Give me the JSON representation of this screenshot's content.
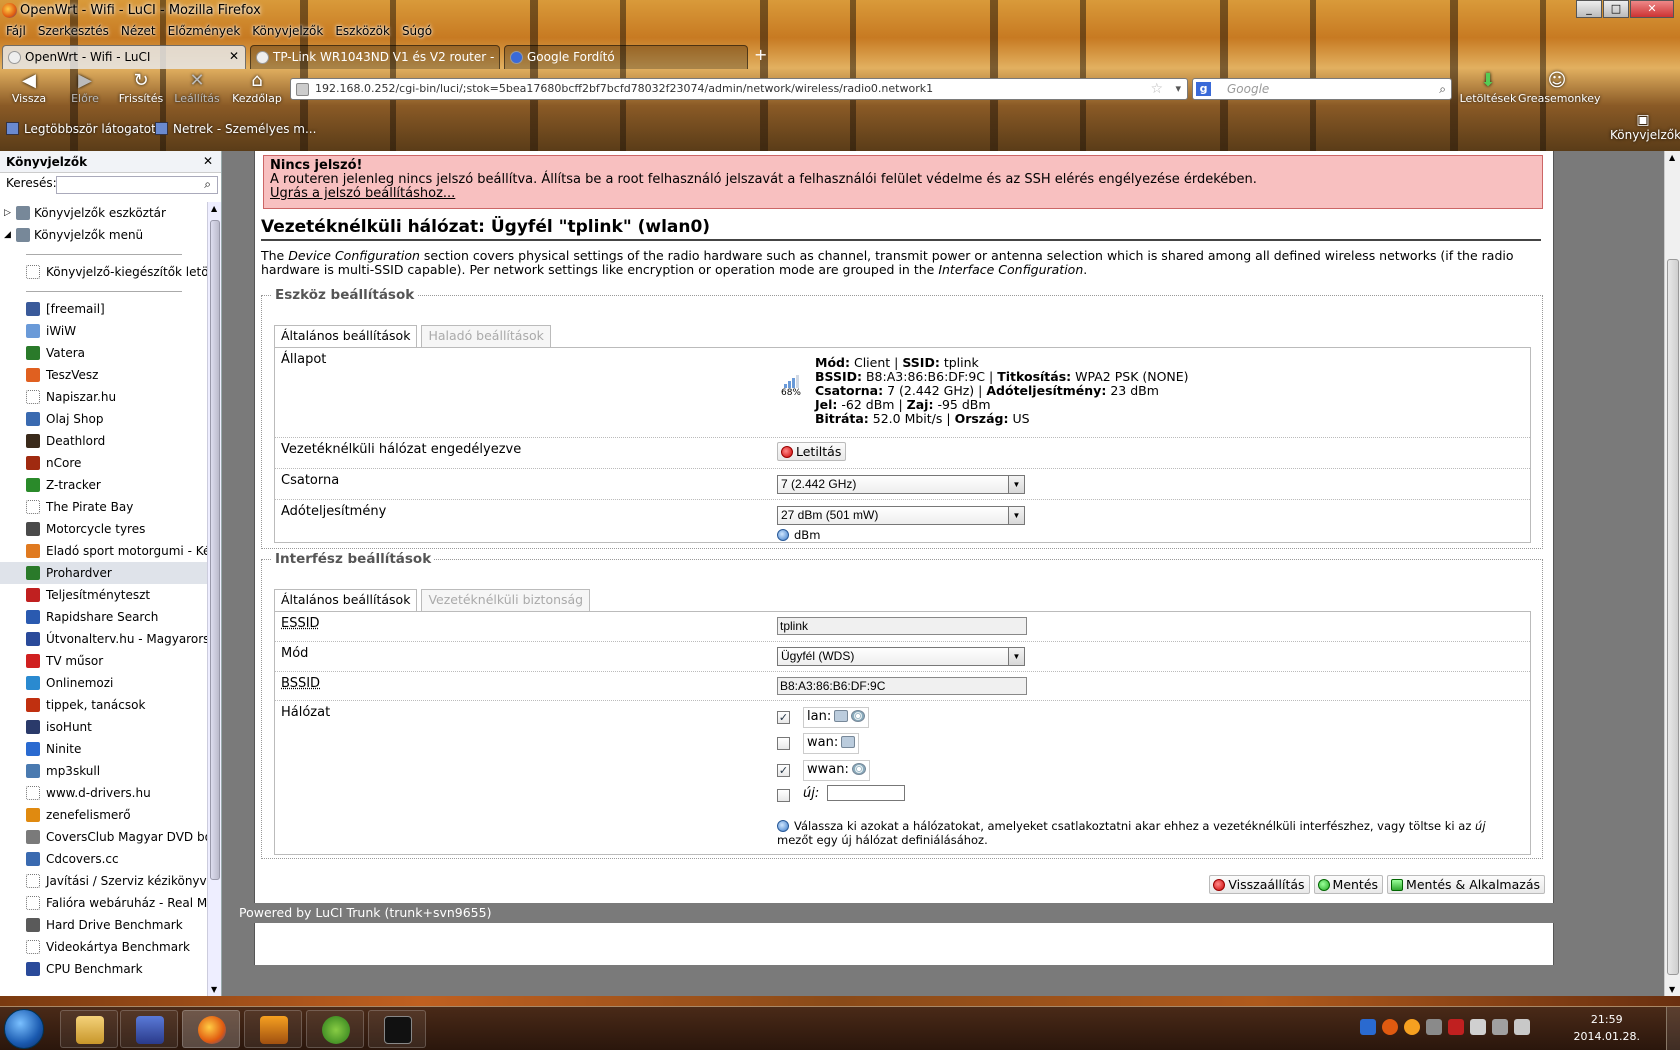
{
  "window": {
    "title": "OpenWrt - Wifi - LuCI - Mozilla Firefox",
    "min": "_",
    "max": "□",
    "close": "✕"
  },
  "menubar": [
    "Fájl",
    "Szerkesztés",
    "Nézet",
    "Előzmények",
    "Könyvjelzők",
    "Eszközök",
    "Súgó"
  ],
  "tabs": [
    {
      "label": "OpenWrt - Wifi - LuCI",
      "active": true
    },
    {
      "label": "TP-Link WR1043ND V1 és V2 router - ...",
      "active": false
    },
    {
      "label": "Google Fordító",
      "active": false
    }
  ],
  "newtab": "+",
  "nav": {
    "back": "Vissza",
    "forward": "Előre",
    "reload": "Frissítés",
    "stop": "Leállítás",
    "home": "Kezdőlap",
    "url": "192.168.0.252/cgi-bin/luci/;stok=5bea17680bcff2bf7bcfd78032f23074/admin/network/wireless/radio0.network1",
    "search_placeholder": "Google",
    "downloads": "Letöltések",
    "greasemonkey": "Greasemonkey"
  },
  "bookmarks_toolbar": {
    "most_visited": "Legtöbbször látogatott",
    "netrek": "Netrek - Személyes m...",
    "sidebar_button": "Könyvjelzők"
  },
  "sidebar": {
    "title": "Könyvjelzők",
    "close": "✕",
    "search_label": "Keresés:",
    "folders": [
      "Könyvjelzők eszköztár",
      "Könyvjelzők menü"
    ],
    "addon_item": "Könyvjelző-kiegészítők letölt...",
    "items": [
      {
        "label": "[freemail]",
        "color": "#3a5a9a"
      },
      {
        "label": "iWiW",
        "color": "#6a9ad8"
      },
      {
        "label": "Vatera",
        "color": "#2a7a2a"
      },
      {
        "label": "TeszVesz",
        "color": "#e06020"
      },
      {
        "label": "Napiszar.hu",
        "color": "#ffffff"
      },
      {
        "label": "Olaj Shop",
        "color": "#3a6ab0"
      },
      {
        "label": "Deathlord",
        "color": "#3a2a1a"
      },
      {
        "label": "nCore",
        "color": "#a02a10"
      },
      {
        "label": "Z-tracker",
        "color": "#2a8a2a"
      },
      {
        "label": "The Pirate Bay",
        "color": "#ffffff"
      },
      {
        "label": "Motorcycle tyres",
        "color": "#4a4a4a"
      },
      {
        "label": "Eladó sport motorgumi - Ké...",
        "color": "#e07a20"
      },
      {
        "label": "Prohardver",
        "color": "#2a7a2a"
      },
      {
        "label": "Teljesítményteszt",
        "color": "#c02020"
      },
      {
        "label": "Rapidshare Search",
        "color": "#2a5ab0"
      },
      {
        "label": "Útvonalterv.hu - Magyarorsz...",
        "color": "#2a4a9a"
      },
      {
        "label": "TV műsor",
        "color": "#d02020"
      },
      {
        "label": "Onlinemozi",
        "color": "#2a8ad0"
      },
      {
        "label": "tippek, tanácsok",
        "color": "#c03010"
      },
      {
        "label": "isoHunt",
        "color": "#2a3a6a"
      },
      {
        "label": "Ninite",
        "color": "#2a6ad0"
      },
      {
        "label": "mp3skull",
        "color": "#4a7ab0"
      },
      {
        "label": "www.d-drivers.hu",
        "color": "#ffffff"
      },
      {
        "label": "zenefelismerő",
        "color": "#e08a10"
      },
      {
        "label": "CoversClub Magyar DVD bo...",
        "color": "#7a7a7a"
      },
      {
        "label": "Cdcovers.cc",
        "color": "#3a6ab0"
      },
      {
        "label": "Javítási / Szerviz kézikönyvek...",
        "color": "#ffffff"
      },
      {
        "label": "Falióra webáruház - Real Ma...",
        "color": "#ffffff"
      },
      {
        "label": "Hard Drive Benchmark",
        "color": "#5a5a5a"
      },
      {
        "label": "Videokártya Benchmark",
        "color": "#ffffff"
      },
      {
        "label": "CPU Benchmark",
        "color": "#2a4a9a"
      }
    ],
    "selected_index": 12
  },
  "luci": {
    "alert": {
      "title": "Nincs jelszó!",
      "text": "A routeren jelenleg nincs jelszó beállítva. Állítsa be a root felhasználó jelszavát a felhasználói felület védelme és az SSH elérés engélyezése érdekében.",
      "link": "Ugrás a jelszó beállításhoz..."
    },
    "page_title": "Vezetéknélküli hálózat: Ügyfél \"tplink\" (wlan0)",
    "intro": {
      "p1": "The ",
      "dc": "Device Configuration",
      "p2": " section covers physical settings of the radio hardware such as channel, transmit power or antenna selection which is shared among all defined wireless networks (if the radio hardware is multi-SSID capable). Per network settings like encryption or operation mode are grouped in the ",
      "ic": "Interface Configuration",
      "p3": "."
    },
    "device": {
      "legend": "Eszköz beállítások",
      "tab_general": "Általános beállítások",
      "tab_advanced": "Haladó beállítások",
      "status_label": "Állapot",
      "signal_percent": "68%",
      "signal_level": 0.68,
      "status": {
        "mode_label": "Mód:",
        "mode": "Client",
        "ssid_label": "SSID:",
        "ssid": "tplink",
        "bssid_label": "BSSID:",
        "bssid": "B8:A3:86:B6:DF:9C",
        "enc_label": "Titkosítás:",
        "enc": "WPA2 PSK (NONE)",
        "channel_label": "Csatorna:",
        "channel": "7 (2.442 GHz)",
        "txpower_label": "Adóteljesítmény:",
        "txpower": "23 dBm",
        "signal_label": "Jel:",
        "signal": "-62 dBm",
        "noise_label": "Zaj:",
        "noise": "-95 dBm",
        "bitrate_label": "Bitráta:",
        "bitrate": "52.0 Mbit/s",
        "country_label": "Ország:",
        "country": "US"
      },
      "enabled_label": "Vezetéknélküli hálózat engedélyezve",
      "disable_button": "Letiltás",
      "channel_label": "Csatorna",
      "channel_value": "7 (2.442 GHz)",
      "txpower_label": "Adóteljesítmény",
      "txpower_value": "27 dBm (501 mW)",
      "txpower_hint": "dBm"
    },
    "iface": {
      "legend": "Interfész beállítások",
      "tab_general": "Általános beállítások",
      "tab_security": "Vezetéknélküli biztonság",
      "essid_label": "ESSID",
      "essid_value": "tplink",
      "mode_label": "Mód",
      "mode_value": "Ügyfél (WDS)",
      "bssid_label": "BSSID",
      "bssid_value": "B8:A3:86:B6:DF:9C",
      "network_label": "Hálózat",
      "networks": [
        {
          "name": "lan:",
          "checked": true
        },
        {
          "name": "wan:",
          "checked": false
        },
        {
          "name": "wwan:",
          "checked": true
        }
      ],
      "new_label": "új:",
      "check_mark": "✓",
      "network_hint_1": "Válassza ki azokat a hálózatokat, amelyeket csatlakoztatni akar ehhez a vezetéknélküli interfészhez, vagy töltse ki az ",
      "network_hint_new": "új",
      "network_hint_2": " mezőt egy új hálózat definiálásához."
    },
    "actions": {
      "reset": "Visszaállítás",
      "save": "Mentés",
      "save_apply": "Mentés & Alkalmazás"
    },
    "footer": "Powered by LuCI Trunk (trunk+svn9655)"
  },
  "taskbar": {
    "time": "21:59",
    "date": "2014.01.28."
  }
}
